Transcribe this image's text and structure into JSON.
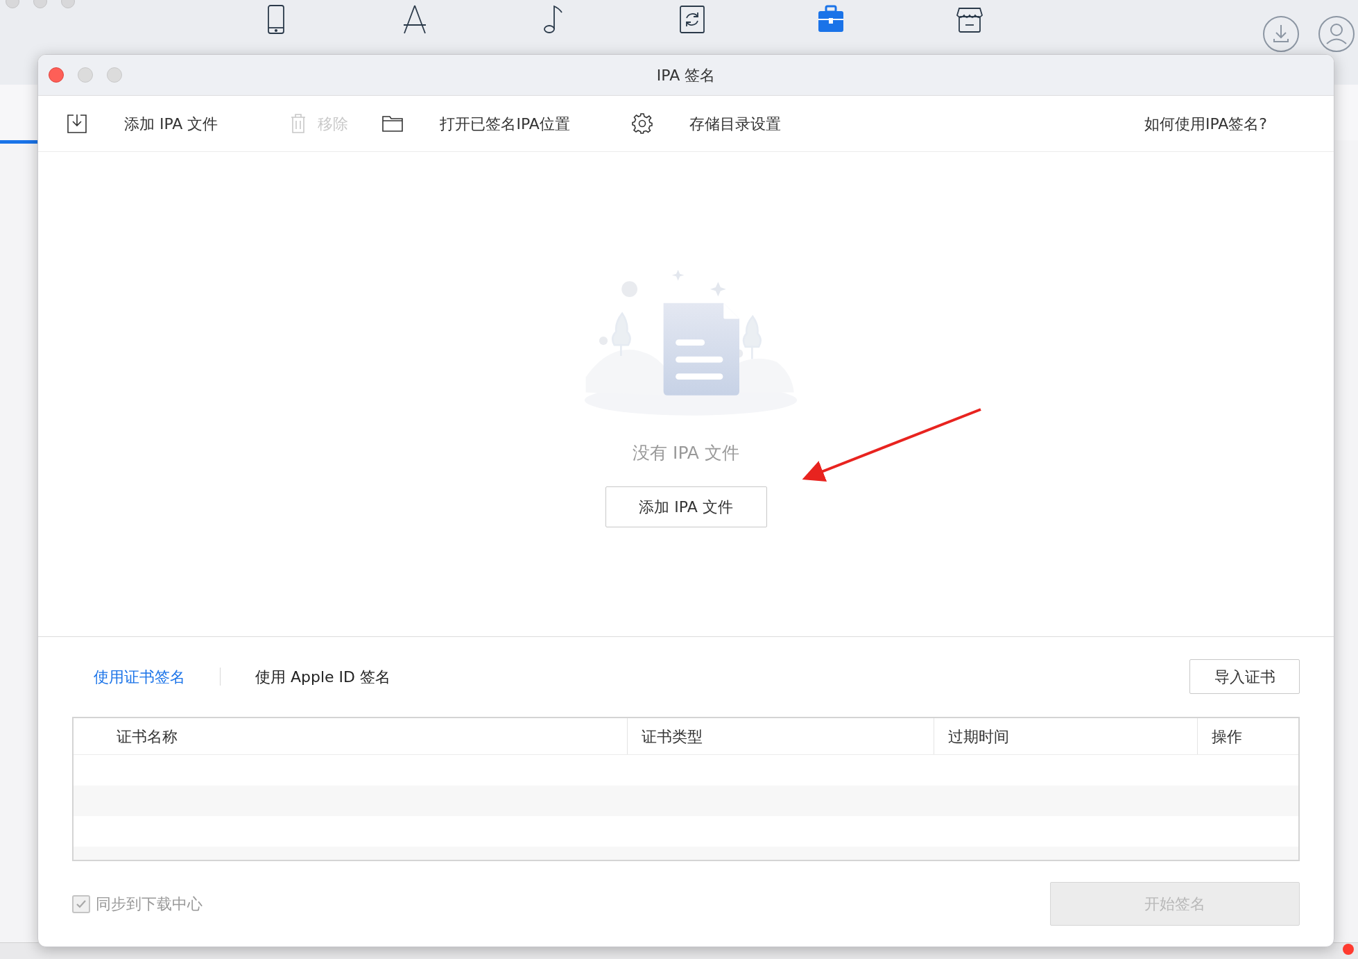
{
  "app_toolbar": {
    "items": [
      {
        "kind": "phone",
        "selected": false
      },
      {
        "kind": "appstore",
        "selected": false
      },
      {
        "kind": "music",
        "selected": false
      },
      {
        "kind": "flash",
        "selected": false
      },
      {
        "kind": "toolbox",
        "selected": true
      },
      {
        "kind": "store",
        "selected": false
      }
    ]
  },
  "dialog": {
    "title": "IPA 签名",
    "toolbar": [
      {
        "kind": "import",
        "label": "添加 IPA 文件",
        "disabled": false
      },
      {
        "kind": "trash",
        "label": "移除",
        "disabled": true
      },
      {
        "kind": "folder",
        "label": "打开已签名IPA位置",
        "disabled": false
      },
      {
        "kind": "gear",
        "label": "存储目录设置",
        "disabled": false
      }
    ],
    "help_link": "如何使用IPA签名?",
    "empty_state": {
      "message": "没有 IPA 文件",
      "button": "添加 IPA 文件"
    },
    "sign_tabs": [
      {
        "label": "使用证书签名",
        "selected": true
      },
      {
        "label": "使用 Apple ID 签名",
        "selected": false
      }
    ],
    "import_button": "导入证书",
    "table": {
      "columns": [
        "证书名称",
        "证书类型",
        "过期时间",
        "操作"
      ]
    },
    "sync_checkbox": {
      "label": "同步到下载中心",
      "checked": true,
      "disabled": true
    },
    "start_button": {
      "label": "开始签名",
      "disabled": true
    }
  }
}
